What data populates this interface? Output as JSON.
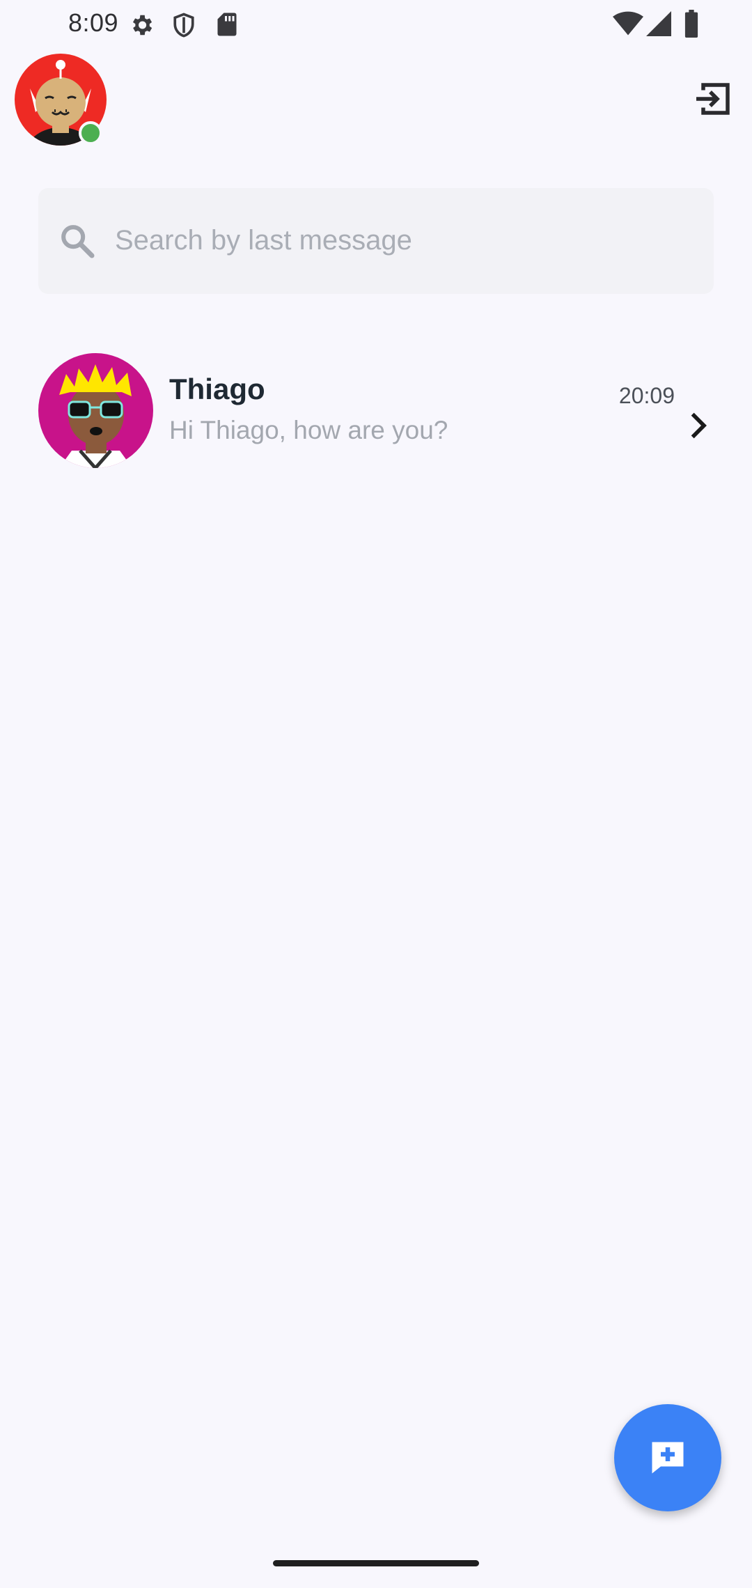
{
  "status_bar": {
    "time": "8:09",
    "icons": [
      "gear-icon",
      "shield-icon",
      "sd-card-icon",
      "wifi-icon",
      "cellular-icon",
      "battery-icon"
    ]
  },
  "header": {
    "profile_avatar": "profile-avatar",
    "online_status_color": "#4CAF50",
    "logout_icon": "logout-icon"
  },
  "search": {
    "placeholder": "Search by last message",
    "value": ""
  },
  "chats": [
    {
      "name": "Thiago",
      "last_message": "Hi Thiago, how are you?",
      "time": "20:09"
    }
  ],
  "fab": {
    "icon": "new-chat-icon",
    "color": "#3B82F6"
  },
  "colors": {
    "background": "#F8F7FD",
    "search_background": "#F2F2F6",
    "accent": "#3B82F6"
  }
}
